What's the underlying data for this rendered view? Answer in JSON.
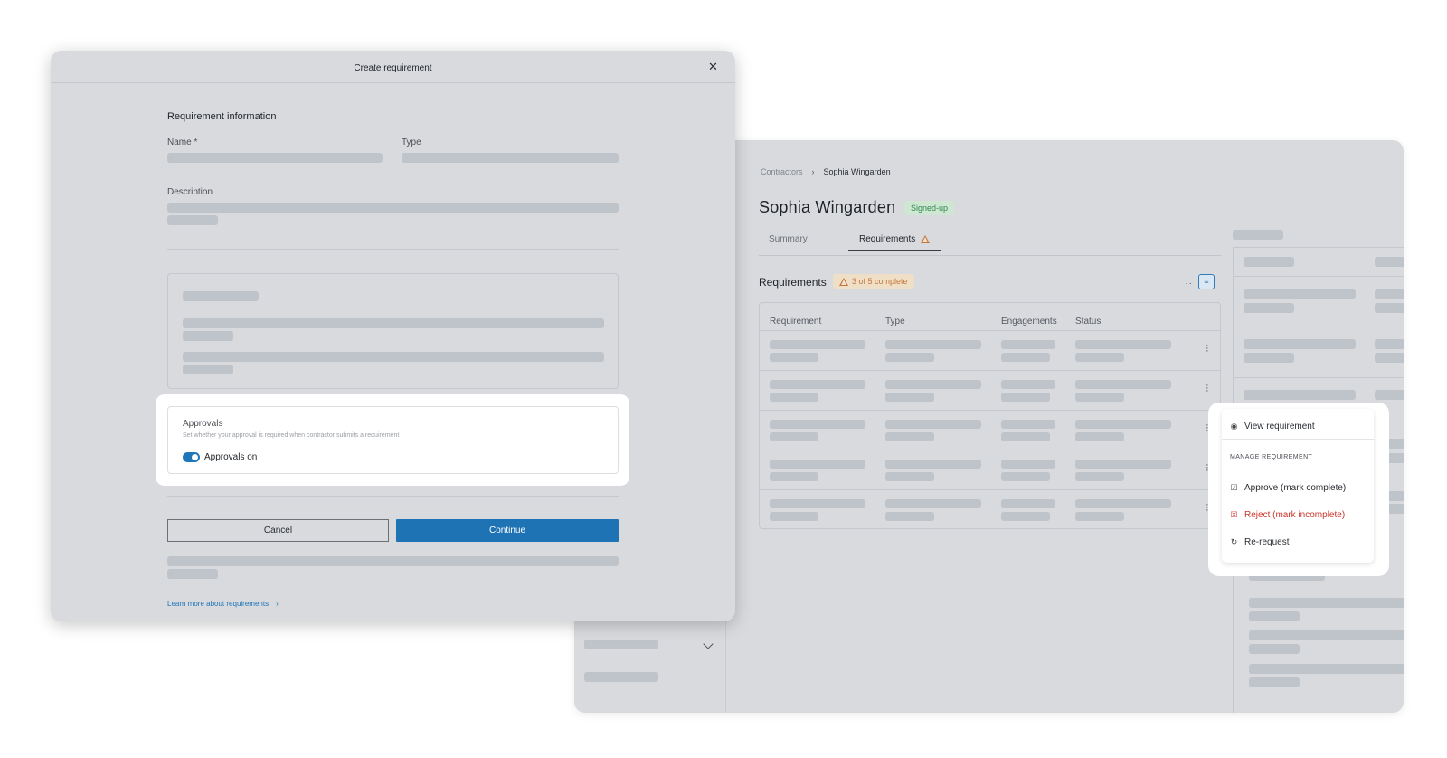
{
  "dialog": {
    "title": "Create requirement",
    "close_icon": "close-icon",
    "section_title": "Requirement information",
    "name_label": "Name *",
    "type_label": "Type",
    "description_label": "Description",
    "approvals": {
      "title": "Approvals",
      "subtitle": "Set whether your approval is required when contractor submits a requirement",
      "toggle_label": "Approvals on",
      "toggle_on": true
    },
    "cancel_label": "Cancel",
    "continue_label": "Continue",
    "learn_more_label": "Learn more about requirements",
    "learn_more_arrow": "›"
  },
  "contractor_page": {
    "breadcrumb": {
      "parent": "Contractors",
      "separator": "›",
      "current": "Sophia Wingarden"
    },
    "person_name": "Sophia Wingarden",
    "status_badge": "Signed-up",
    "tabs": [
      {
        "label": "Summary"
      },
      {
        "label": "Requirements"
      }
    ],
    "requirements_title": "Requirements",
    "progress_badge": "3 of 5 complete",
    "columns": [
      "Requirement",
      "Type",
      "Engagements",
      "Status"
    ],
    "view_grid_icon": "∷",
    "view_list_icon": "≡"
  },
  "context_menu": {
    "view_label": "View requirement",
    "section_header": "MANAGE REQUIREMENT",
    "approve_label": "Approve (mark complete)",
    "reject_label": "Reject (mark incomplete)",
    "rerequest_label": "Re-request"
  },
  "colors": {
    "primary": "#1e73b5",
    "success_badge": "#2f8a4f",
    "warning_badge": "#c5763a",
    "danger": "#c9352b"
  }
}
